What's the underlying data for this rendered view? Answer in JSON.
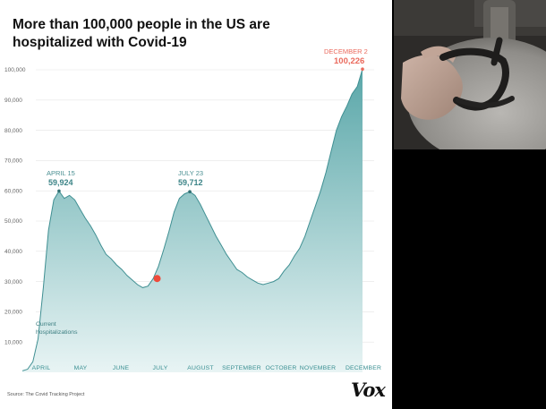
{
  "headline": "More than 100,000 people in the US are hospitalized with Covid-19",
  "source": "Source: The Covid Tracking Project",
  "brand": "Vox",
  "colors": {
    "area_top": "#5aa7a9",
    "area_bottom": "#e8f4f4",
    "line": "#3f8f92",
    "highlight": "#ee4b3b",
    "annotation": "#ea6a5d"
  },
  "chart_data": {
    "type": "area",
    "title": "More than 100,000 people in the US are hospitalized with Covid-19",
    "xlabel": "",
    "ylabel": "",
    "ylim": [
      0,
      100000
    ],
    "y_ticks": [
      "10,000",
      "20,000",
      "30,000",
      "40,000",
      "50,000",
      "60,000",
      "70,000",
      "80,000",
      "90,000",
      "100,000"
    ],
    "x_ticks": [
      "APRIL",
      "MAY",
      "JUNE",
      "JULY",
      "AUGUST",
      "SEPTEMBER",
      "OCTOBER",
      "NOVEMBER",
      "DECEMBER"
    ],
    "grid": true,
    "series": [
      {
        "name": "Current hospitalizations",
        "x": [
          "Mar 18",
          "Mar 22",
          "Mar 26",
          "Mar 30",
          "Apr 3",
          "Apr 7",
          "Apr 11",
          "Apr 15",
          "Apr 19",
          "Apr 23",
          "Apr 27",
          "May 1",
          "May 5",
          "May 9",
          "May 13",
          "May 17",
          "May 21",
          "May 25",
          "May 29",
          "Jun 2",
          "Jun 6",
          "Jun 10",
          "Jun 14",
          "Jun 18",
          "Jun 22",
          "Jun 26",
          "Jun 30",
          "Jul 4",
          "Jul 8",
          "Jul 12",
          "Jul 16",
          "Jul 20",
          "Jul 23",
          "Jul 27",
          "Jul 31",
          "Aug 4",
          "Aug 8",
          "Aug 12",
          "Aug 16",
          "Aug 20",
          "Aug 24",
          "Aug 28",
          "Sep 1",
          "Sep 5",
          "Sep 9",
          "Sep 13",
          "Sep 17",
          "Sep 21",
          "Sep 25",
          "Sep 29",
          "Oct 3",
          "Oct 7",
          "Oct 11",
          "Oct 15",
          "Oct 19",
          "Oct 23",
          "Oct 27",
          "Oct 31",
          "Nov 4",
          "Nov 8",
          "Nov 12",
          "Nov 16",
          "Nov 20",
          "Nov 24",
          "Nov 28",
          "Dec 2"
        ],
        "values": [
          500,
          1000,
          3500,
          11000,
          28000,
          47000,
          57000,
          59924,
          57500,
          58500,
          57000,
          54000,
          51000,
          48500,
          45500,
          42000,
          39000,
          37500,
          35500,
          34000,
          32000,
          30500,
          29000,
          28000,
          28500,
          31000,
          35000,
          40500,
          46500,
          53000,
          57500,
          59000,
          59712,
          58500,
          55500,
          52000,
          48500,
          45000,
          42000,
          39000,
          36500,
          34000,
          33000,
          31500,
          30500,
          29500,
          29000,
          29500,
          30000,
          31000,
          33500,
          35500,
          38500,
          41000,
          45000,
          50000,
          55000,
          60000,
          66000,
          73000,
          80000,
          84500,
          88000,
          92000,
          94500,
          100226
        ]
      }
    ],
    "annotations": [
      {
        "label": "APRIL 15",
        "value": "59,924"
      },
      {
        "label": "JULY 23",
        "value": "59,712"
      },
      {
        "label": "DECEMBER 2",
        "value": "100,226"
      }
    ],
    "series_label": [
      "Current",
      "hospitalizations"
    ],
    "highlight_marker": {
      "x": "Jun 29",
      "y": 31000
    }
  }
}
